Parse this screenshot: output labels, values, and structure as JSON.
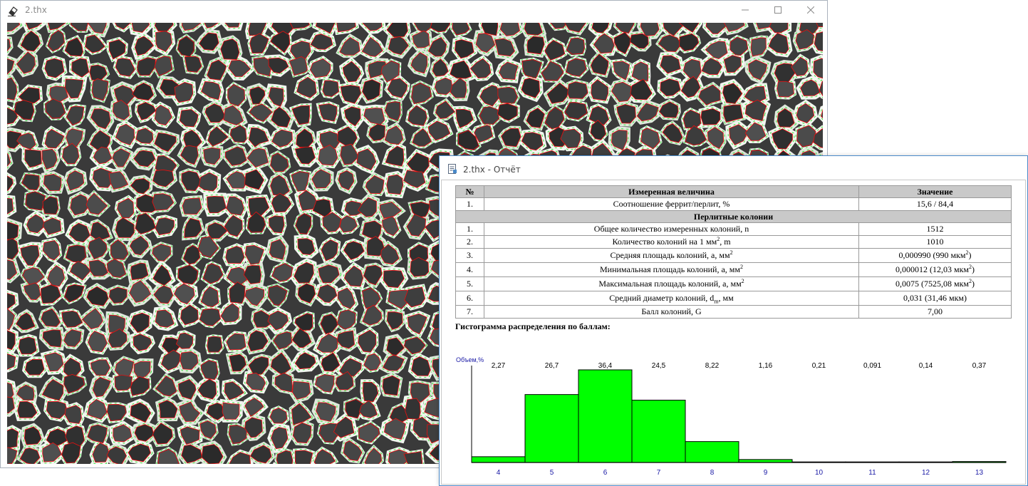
{
  "image_window": {
    "title": "2.thx",
    "icon": "eraser-icon"
  },
  "report_window": {
    "title": "2.thx - Отчёт",
    "icon": "report-icon"
  },
  "table": {
    "headers": [
      "№",
      "Измеренная величина",
      "Значение"
    ],
    "ratio_row": {
      "num": "1.",
      "label": "Соотношение феррит/перлит, %",
      "value": "15,6 / 84,4"
    },
    "section_title": "Перлитные колонии",
    "rows": [
      {
        "num": "1.",
        "label": "Общее количество измеренных колоний, n",
        "value": "1512"
      },
      {
        "num": "2.",
        "label_pre": "Количество колоний на 1 мм",
        "label_sup": "2",
        "label_post": ", m",
        "value": "1010"
      },
      {
        "num": "3.",
        "label_pre": "Средняя площадь колоний, a, мм",
        "label_sup": "2",
        "value_pre": "0,000990 (990 мкм",
        "value_sup": "2",
        "value_post": ")"
      },
      {
        "num": "4.",
        "label_pre": "Минимальная площадь колоний, a, мм",
        "label_sup": "2",
        "value_pre": "0,000012 (12,03 мкм",
        "value_sup": "2",
        "value_post": ")"
      },
      {
        "num": "5.",
        "label_pre": "Максимальная площадь колоний, a, мм",
        "label_sup": "2",
        "value_pre": "0,0075 (7525,08 мкм",
        "value_sup": "2",
        "value_post": ")"
      },
      {
        "num": "6.",
        "label_pre": "Средний диаметр колоний, d",
        "label_sub": "m",
        "label_post": ", мм",
        "value": "0,031 (31,46 мкм)"
      },
      {
        "num": "7.",
        "label": "Балл колоний, G",
        "value": "7,00"
      }
    ]
  },
  "histogram_title": "Гистограмма распределения по баллам:",
  "chart_data": {
    "type": "bar",
    "ylabel": "Объем,%",
    "categories": [
      "4",
      "5",
      "6",
      "7",
      "8",
      "9",
      "10",
      "11",
      "12",
      "13"
    ],
    "values": [
      2.27,
      26.7,
      36.4,
      24.5,
      8.22,
      1.16,
      0.21,
      0.091,
      0.14,
      0.37
    ],
    "value_labels": [
      "2,27",
      "26,7",
      "36,4",
      "24,5",
      "8,22",
      "1,16",
      "0,21",
      "0,091",
      "0,14",
      "0,37"
    ],
    "ylim": [
      0,
      36.4
    ],
    "bar_color": "#00ff00",
    "label_color": "#1a1aa6"
  },
  "colors": {
    "grain_boundary": "#e01010",
    "ferrite_edge": "#40e040",
    "report_border": "#4a8ac9"
  }
}
